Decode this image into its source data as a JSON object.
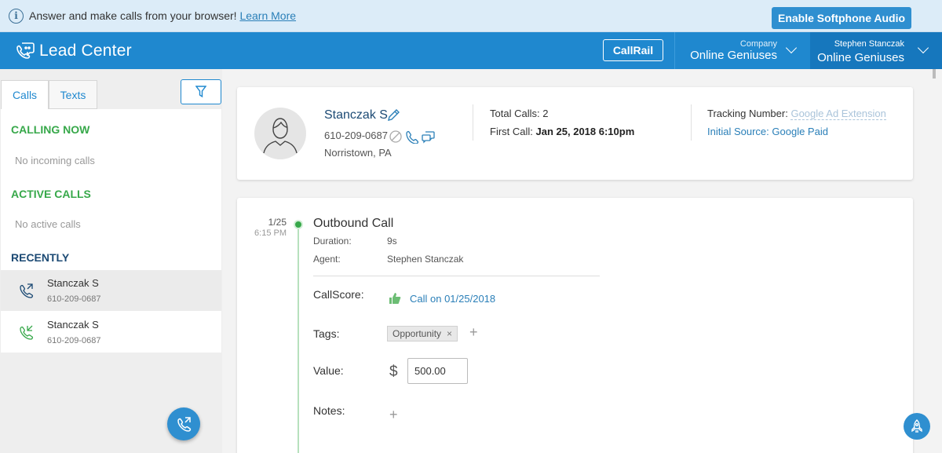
{
  "banner": {
    "message": "Answer and make calls from your browser!",
    "learn_more": "Learn More",
    "softphone_button": "Enable Softphone Audio"
  },
  "nav": {
    "app_name": "Lead Center",
    "callrail_button": "CallRail",
    "company_label": "Company",
    "company_name": "Online Geniuses",
    "user_label": "Stephen Stanczak",
    "user_company": "Online Geniuses"
  },
  "sidebar": {
    "tabs": [
      {
        "label": "Calls",
        "active": true
      },
      {
        "label": "Texts",
        "active": false
      }
    ],
    "calling_now": {
      "heading": "CALLING NOW",
      "empty": "No incoming calls"
    },
    "active_calls": {
      "heading": "ACTIVE CALLS",
      "empty": "No active calls"
    },
    "recently": {
      "heading": "RECENTLY",
      "items": [
        {
          "name": "Stanczak S",
          "number": "610-209-0687",
          "icon": "outgoing-call-icon",
          "selected": true
        },
        {
          "name": "Stanczak S",
          "number": "610-209-0687",
          "icon": "incoming-call-icon",
          "selected": false
        }
      ]
    }
  },
  "contact": {
    "name": "Stanczak S",
    "phone": "610-209-0687",
    "location": "Norristown, PA",
    "total_calls_label": "Total Calls:",
    "total_calls_value": "2",
    "first_call_label": "First Call:",
    "first_call_value": "Jan 25, 2018 6:10pm",
    "tracking_label": "Tracking Number:",
    "tracking_value": "Google Ad Extension",
    "initial_source_label": "Initial Source:",
    "initial_source_value": "Google Paid"
  },
  "timeline": {
    "date": "1/25",
    "time": "6:15 PM",
    "title": "Outbound Call",
    "duration_label": "Duration:",
    "duration_value": "9s",
    "agent_label": "Agent:",
    "agent_value": "Stephen Stanczak",
    "callscore_label": "CallScore:",
    "callscore_link": "Call on 01/25/2018",
    "tags_label": "Tags:",
    "tags": [
      "Opportunity"
    ],
    "value_label": "Value:",
    "value_currency": "$",
    "value_amount": "500.00",
    "notes_label": "Notes:"
  },
  "colors": {
    "primary": "#1f88cf",
    "green": "#37a84a",
    "navy": "#1c4a74"
  }
}
